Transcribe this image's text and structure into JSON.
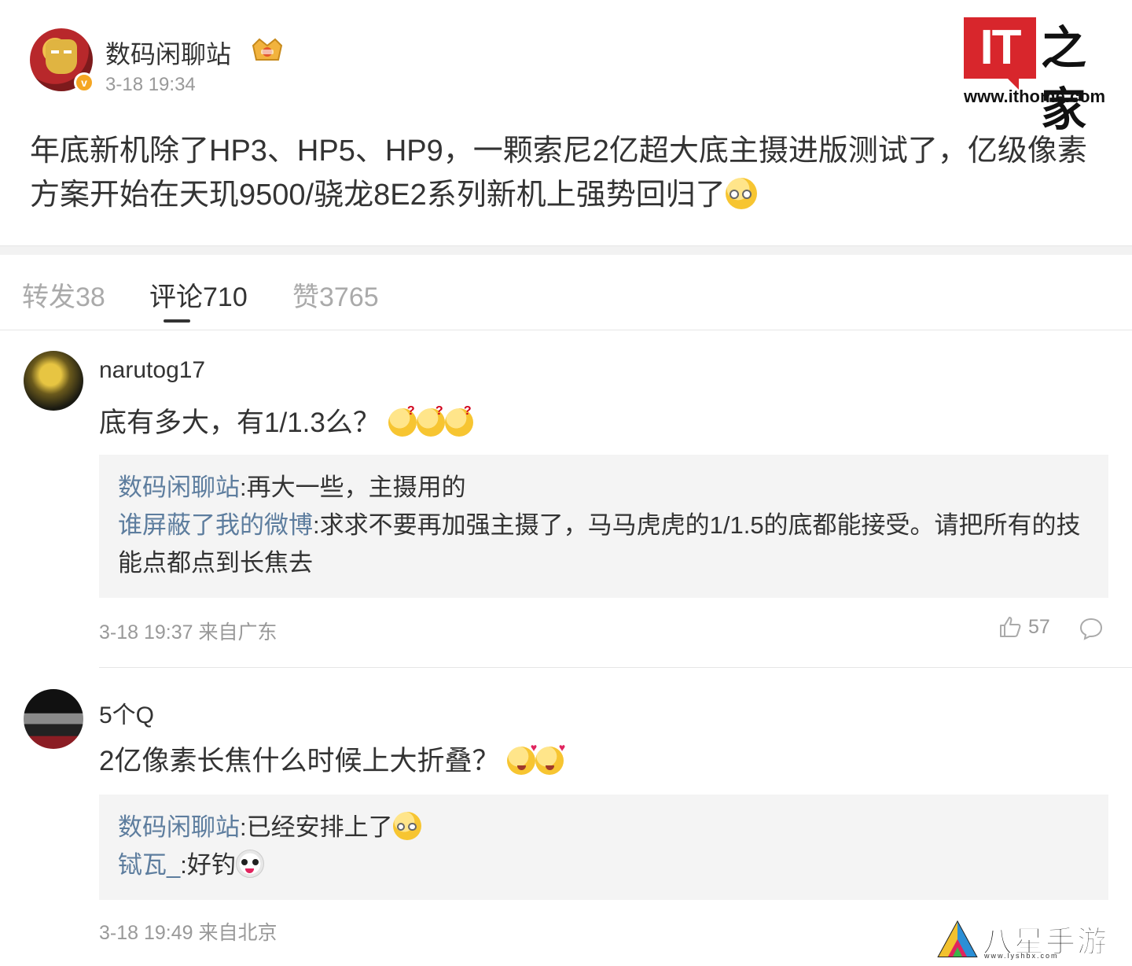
{
  "post": {
    "author": "数码闲聊站",
    "verified_mark": "v",
    "time": "3-18 19:34",
    "body": "年底新机除了HP3、HP5、HP9，一颗索尼2亿超大底主摄进版测试了，亿级像素方案开始在天玑9500/骁龙8E2系列新机上强势回归了",
    "body_emoji": "glasses-emoji"
  },
  "logo": {
    "it": "IT",
    "cn": "之家",
    "url": "www.ithome.com"
  },
  "tabs": [
    {
      "label": "转发38",
      "active": false
    },
    {
      "label": "评论710",
      "active": true
    },
    {
      "label": "赞3765",
      "active": false
    }
  ],
  "comments": [
    {
      "user": "narutog17",
      "text": "底有多大，有1/1.3么？",
      "emojis": [
        "confused-emoji",
        "confused-emoji",
        "confused-emoji"
      ],
      "replies": [
        {
          "user": "数码闲聊站",
          "text": ":再大一些，主摄用的"
        },
        {
          "user": "谁屏蔽了我的微博",
          "text": ":求求不要再加强主摄了，马马虎虎的1/1.5的底都能接受。请把所有的技能点都点到长焦去"
        }
      ],
      "meta": "3-18 19:37 来自广东",
      "likes": "57"
    },
    {
      "user": "5个Q",
      "text": "2亿像素长焦什么时候上大折叠？",
      "emojis": [
        "love-emoji",
        "love-emoji"
      ],
      "replies": [
        {
          "user": "数码闲聊站",
          "text": ":已经安排上了",
          "emoji": "glasses-emoji"
        },
        {
          "user": "铽瓦_",
          "text": ":好钓",
          "emoji": "panda-emoji"
        }
      ],
      "meta": "3-18 19:49 来自北京"
    }
  ],
  "watermark": {
    "name": "八星手游网",
    "url": "www.lyshbx.com"
  },
  "colors": {
    "link_blue": "#5d7d9e",
    "ithome_red": "#d8262c",
    "muted": "#999999"
  }
}
